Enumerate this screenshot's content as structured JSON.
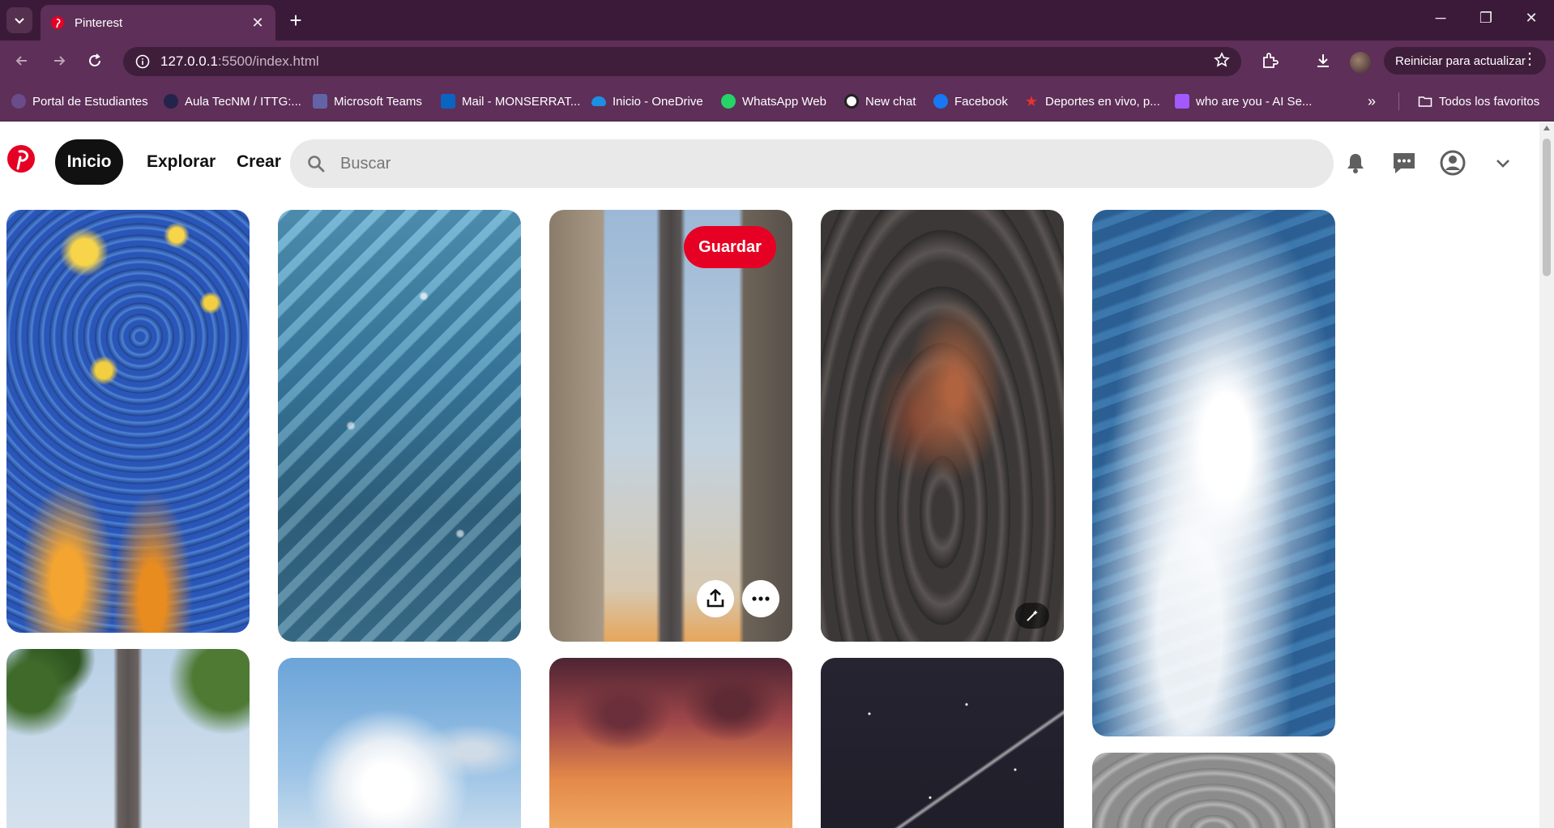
{
  "browser": {
    "tab_title": "Pinterest",
    "url_host": "127.0.0.1",
    "url_rest": ":5500/index.html",
    "update_button": "Reiniciar para actualizar",
    "bookmarks": [
      {
        "label": "Portal de Estudiantes",
        "icon": "portal-icon",
        "color": "#6b4c8a"
      },
      {
        "label": "Aula TecNM / ITTG:...",
        "icon": "tecnm-icon",
        "color": "#23244a"
      },
      {
        "label": "Microsoft Teams",
        "icon": "teams-icon",
        "color": "#6264a7"
      },
      {
        "label": "Mail - MONSERRAT...",
        "icon": "outlook-icon",
        "color": "#0a64c2"
      },
      {
        "label": "Inicio - OneDrive",
        "icon": "onedrive-icon",
        "color": "#1c8fe2"
      },
      {
        "label": "WhatsApp Web",
        "icon": "whatsapp-icon",
        "color": "#25d366"
      },
      {
        "label": "New chat",
        "icon": "openai-icon",
        "color": "#ffffff"
      },
      {
        "label": "Facebook",
        "icon": "facebook-icon",
        "color": "#1877f2"
      },
      {
        "label": "Deportes en vivo, p...",
        "icon": "star-icon",
        "color": "#e8332a"
      },
      {
        "label": "who are you - AI Se...",
        "icon": "ai-search-icon",
        "color": "#a259ff"
      }
    ],
    "all_bookmarks": "Todos los favoritos"
  },
  "pinterest": {
    "nav": {
      "home": "Inicio",
      "explore": "Explorar",
      "create": "Crear"
    },
    "search_placeholder": "Buscar",
    "save_label": "Guardar",
    "brand_color": "#e60023"
  }
}
